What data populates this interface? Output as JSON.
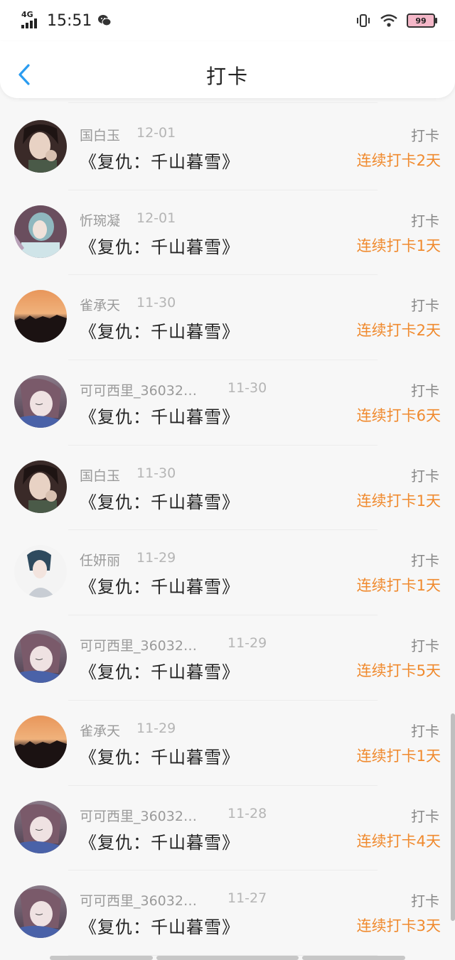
{
  "status_bar": {
    "network": "4G",
    "time": "15:51",
    "battery": "99"
  },
  "header": {
    "title": "打卡"
  },
  "entries": [
    {
      "name": "国白玉",
      "date": "12-01",
      "book": "《复仇：千山暮雪》",
      "action": "打卡",
      "streak": "连续打卡2天"
    },
    {
      "name": "忻琬凝",
      "date": "12-01",
      "book": "《复仇：千山暮雪》",
      "action": "打卡",
      "streak": "连续打卡1天"
    },
    {
      "name": "雀承天",
      "date": "11-30",
      "book": "《复仇：千山暮雪》",
      "action": "打卡",
      "streak": "连续打卡2天"
    },
    {
      "name": "可可西里_36032…",
      "date": "11-30",
      "book": "《复仇：千山暮雪》",
      "action": "打卡",
      "streak": "连续打卡6天"
    },
    {
      "name": "国白玉",
      "date": "11-30",
      "book": "《复仇：千山暮雪》",
      "action": "打卡",
      "streak": "连续打卡1天"
    },
    {
      "name": "任妍丽",
      "date": "11-29",
      "book": "《复仇：千山暮雪》",
      "action": "打卡",
      "streak": "连续打卡1天"
    },
    {
      "name": "可可西里_36032…",
      "date": "11-29",
      "book": "《复仇：千山暮雪》",
      "action": "打卡",
      "streak": "连续打卡5天"
    },
    {
      "name": "雀承天",
      "date": "11-29",
      "book": "《复仇：千山暮雪》",
      "action": "打卡",
      "streak": "连续打卡1天"
    },
    {
      "name": "可可西里_36032…",
      "date": "11-28",
      "book": "《复仇：千山暮雪》",
      "action": "打卡",
      "streak": "连续打卡4天"
    },
    {
      "name": "可可西里_36032…",
      "date": "11-27",
      "book": "《复仇：千山暮雪》",
      "action": "打卡",
      "streak": "连续打卡3天"
    }
  ],
  "colors": {
    "accent": "#f08a2e",
    "back": "#2a9cf0"
  }
}
